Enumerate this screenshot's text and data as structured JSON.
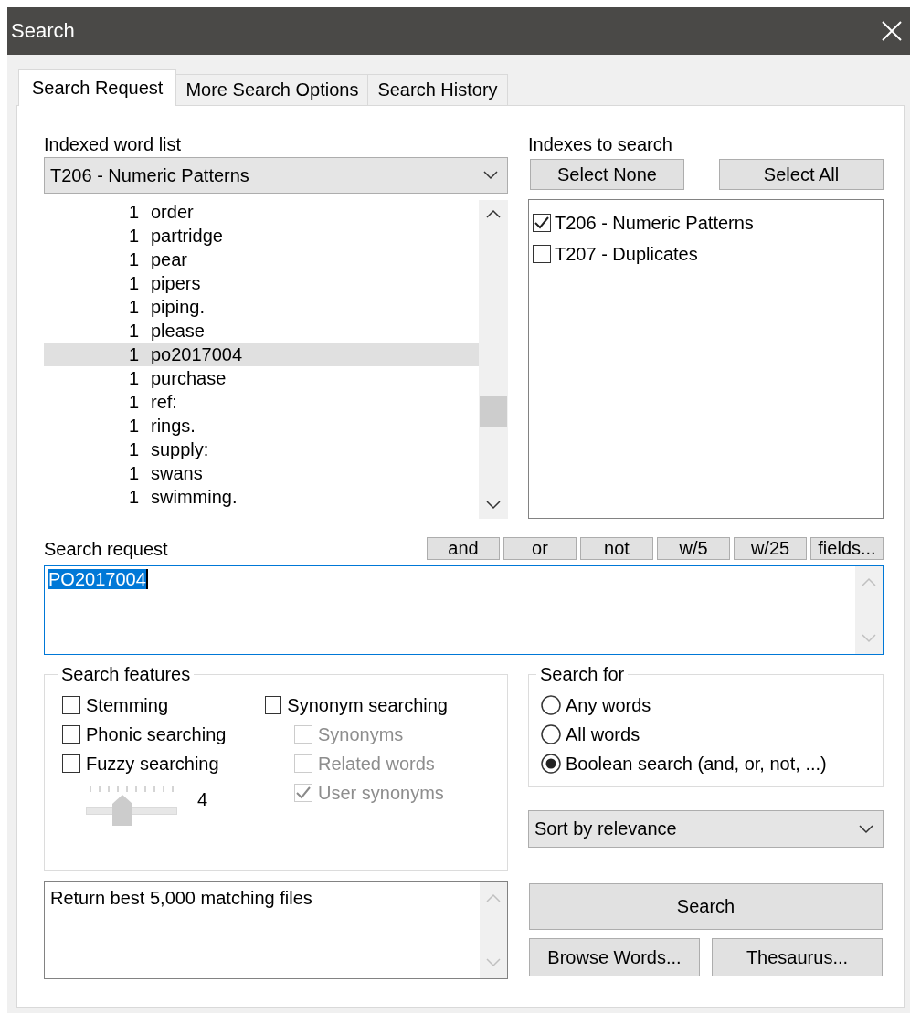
{
  "window": {
    "title": "Search"
  },
  "tabs": [
    {
      "label": "Search Request",
      "selected": true
    },
    {
      "label": "More Search Options",
      "selected": false
    },
    {
      "label": "Search History",
      "selected": false
    }
  ],
  "word_list": {
    "label": "Indexed word list",
    "index": "T206 - Numeric Patterns",
    "rows": [
      {
        "count": "1",
        "word": "order",
        "selected": false
      },
      {
        "count": "1",
        "word": "partridge",
        "selected": false
      },
      {
        "count": "1",
        "word": "pear",
        "selected": false
      },
      {
        "count": "1",
        "word": "pipers",
        "selected": false
      },
      {
        "count": "1",
        "word": "piping.",
        "selected": false
      },
      {
        "count": "1",
        "word": "please",
        "selected": false
      },
      {
        "count": "1",
        "word": "po2017004",
        "selected": true
      },
      {
        "count": "1",
        "word": "purchase",
        "selected": false
      },
      {
        "count": "1",
        "word": "ref:",
        "selected": false
      },
      {
        "count": "1",
        "word": "rings.",
        "selected": false
      },
      {
        "count": "1",
        "word": "supply:",
        "selected": false
      },
      {
        "count": "1",
        "word": "swans",
        "selected": false
      },
      {
        "count": "1",
        "word": "swimming.",
        "selected": false
      }
    ]
  },
  "indexes": {
    "label": "Indexes to search",
    "buttons": [
      "Select None",
      "Select All"
    ],
    "items": [
      {
        "label": "T206 - Numeric Patterns",
        "checked": true
      },
      {
        "label": "T207 - Duplicates",
        "checked": false
      }
    ]
  },
  "search_request": {
    "label": "Search request",
    "operators": [
      "and",
      "or",
      "not",
      "w/5",
      "w/25",
      "fields..."
    ],
    "value": "PO2017004",
    "value_selected": true
  },
  "search_features": {
    "title": "Search features",
    "options": [
      {
        "label": "Stemming",
        "checked": false,
        "disabled": false
      },
      {
        "label": "Phonic searching",
        "checked": false,
        "disabled": false
      },
      {
        "label": "Fuzzy searching",
        "checked": false,
        "disabled": false
      }
    ],
    "synonym_options": [
      {
        "label": "Synonym searching",
        "checked": false,
        "disabled": false
      },
      {
        "label": "Synonyms",
        "checked": false,
        "disabled": true
      },
      {
        "label": "Related words",
        "checked": false,
        "disabled": true
      },
      {
        "label": "User synonyms",
        "checked": true,
        "disabled": true
      }
    ],
    "fuzziness": {
      "level": 0.4,
      "reading": "4",
      "disabled": true
    }
  },
  "search_for": {
    "title": "Search for",
    "options": [
      {
        "label": "Any words",
        "selected": false
      },
      {
        "label": "All words",
        "selected": false
      },
      {
        "label": "Boolean search (and, or, not, ...)",
        "selected": true
      }
    ]
  },
  "sort": {
    "value": "Sort by relevance"
  },
  "result_limit": {
    "text": "Return best 5,000 matching files"
  },
  "buttons": [
    {
      "label": "Search"
    },
    {
      "label": "Browse Words..."
    },
    {
      "label": "Thesaurus..."
    }
  ]
}
